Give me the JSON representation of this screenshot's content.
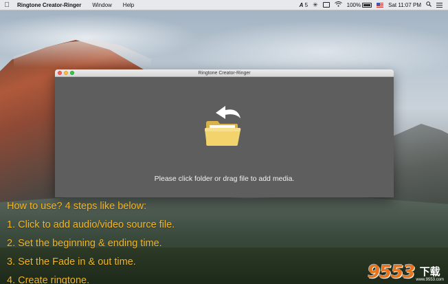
{
  "menubar": {
    "app_name": "Ringtone Creator-Ringer",
    "items": [
      "Window",
      "Help"
    ],
    "status": {
      "adobe_label": "5",
      "battery_percent": "100%",
      "datetime": "Sat 11:07 PM"
    }
  },
  "window": {
    "title": "Ringtone Creator-Ringer",
    "drop_hint": "Please click folder or drag file to add media."
  },
  "howto": {
    "heading": "How to use?  4 steps like below:",
    "steps": [
      "1. Click to add audio/video source file.",
      "2. Set the beginning & ending time.",
      "3. Set the Fade in & out time.",
      "4. Create ringtone."
    ]
  },
  "watermark": {
    "number": "9553",
    "chinese": "下载",
    "url": "www.9553.com"
  },
  "icons": {
    "apple": "apple-icon",
    "folder": "folder-open-icon",
    "arrow": "curved-arrow-icon"
  },
  "colors": {
    "howto_text": "#f2b523",
    "window_content": "#5e5e5e",
    "watermark_accent": "#e8731b"
  }
}
